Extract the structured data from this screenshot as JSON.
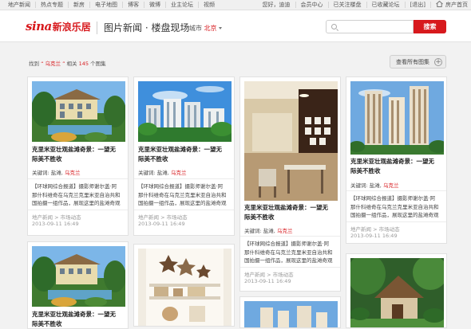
{
  "topbar": {
    "left_links": [
      "地产新闻",
      "热点专题",
      "新房",
      "电子地图",
      "博客",
      "微博",
      "业主论坛",
      "视频"
    ],
    "right_links": [
      "您好，迪迪",
      "会员中心",
      "已关注楼盘",
      "已收藏论坛",
      "[退出]"
    ],
    "home_label": "房产首页"
  },
  "header": {
    "logo_sina": "sina",
    "logo_cn": "新浪乐居",
    "title": "图片新闻 · 楼盘现场",
    "city_label": "城市",
    "city_value": "北京",
    "search_placeholder": "",
    "search_button": "搜索"
  },
  "results": {
    "prefix": "找到",
    "keyword": "“ 乌克兰 ”",
    "middle": "相关",
    "count": "145",
    "suffix": "个图集",
    "view_all": "查看所有图集"
  },
  "cards": [
    {
      "title": "克里米亚壮观盐滩奇景：一望无际美不胜收",
      "kw_label": "关键词:",
      "kw_plain": "盐滩,",
      "kw_red": "乌克兰",
      "desc": "【环球网综合报道】摄影师谢尔盖·阿那什科维奇在乌克兰克里米亚自治共和国拍摄一组作品，展现这里的盐滩奇观",
      "source": "地产新闻 > 市场动态",
      "date": "2013-09-11 16:49",
      "scene": "villa"
    },
    {
      "title": "克里米亚壮观盐滩奇景：一望无际美不胜收",
      "kw_label": "关键词:",
      "kw_plain": "盐滩,",
      "kw_red": "乌克兰",
      "desc": "【环球网综合报道】摄影师谢尔盖·阿那什科维奇在乌克兰克里米亚自治共和国拍摄一组作品，展现这里的盐滩奇观",
      "source": "地产新闻 > 市场动态",
      "date": "2013-09-11 16:49",
      "scene": "apartments"
    },
    {
      "title": "克里米亚壮观盐滩奇景：一望无际美不胜收",
      "kw_label": "关键词:",
      "kw_plain": "盐滩,",
      "kw_red": "乌克兰",
      "desc": "【环球网综合报道】摄影师谢尔盖·阿那什科维奇在乌克兰克里米亚自治共和国拍摄一组作品，展现这里的盐滩奇观",
      "source": "地产新闻 > 市场动态",
      "date": "2013-09-11 16:49",
      "scene": "interior"
    },
    {
      "title": "克里米亚壮观盐滩奇景：一望无际美不胜收",
      "kw_label": "关键词:",
      "kw_plain": "盐滩,",
      "kw_red": "乌克兰",
      "desc": "【环球网综合报道】摄影师谢尔盖·阿那什科维奇在乌克兰克里米亚自治共和国拍摄一组作品，展现这里的盐滩奇观",
      "source": "地产新闻 > 市场动态",
      "date": "2013-09-11 16:49",
      "scene": "towers"
    },
    {
      "title": "克里米亚壮观盐滩奇景：一望无际美不胜收",
      "scene": "villa"
    },
    {
      "title": "",
      "scene": "shelves"
    },
    {
      "title": "",
      "scene": "towers_small"
    },
    {
      "title": "",
      "scene": "hut"
    }
  ]
}
